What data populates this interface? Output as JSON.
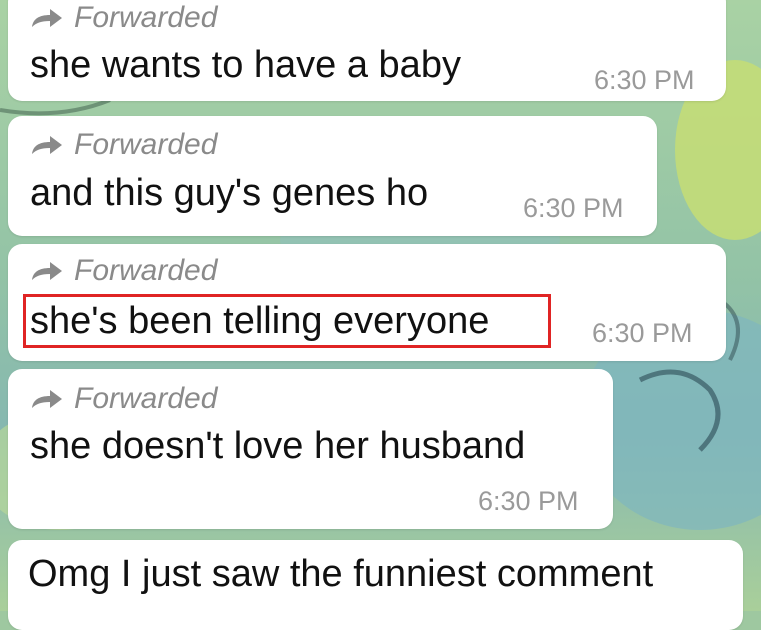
{
  "forwarded_label": "Forwarded",
  "messages": [
    {
      "text": "she wants to have a baby",
      "time": "6:30 PM",
      "forwarded": true
    },
    {
      "text": "and this guy's genes ho",
      "time": "6:30 PM",
      "forwarded": true
    },
    {
      "text": "she's been telling everyone",
      "time": "6:30 PM",
      "forwarded": true,
      "highlighted": true
    },
    {
      "text": "she doesn't love her husband",
      "time": "6:30 PM",
      "forwarded": true
    },
    {
      "text": "Omg I just saw the funniest comment",
      "forwarded": false
    }
  ],
  "colors": {
    "bubble": "#ffffff",
    "highlight_border": "#e02424",
    "forwarded_text": "#8a8a8a",
    "timestamp_text": "#9a9a9a",
    "wallpaper": "#9ec8a0"
  },
  "icons": {
    "forward": "forward-arrow-icon"
  }
}
